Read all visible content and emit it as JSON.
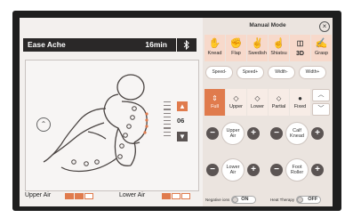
{
  "program": {
    "name": "Ease Ache",
    "time": "16min"
  },
  "bluetooth_icon": "bluetooth-icon",
  "body_panel": {
    "scroll_icon": "scroll-toggle-icon",
    "position_value": "06",
    "up_arrow": "▲",
    "down_arrow": "▼"
  },
  "air": {
    "upper_label": "Upper Air",
    "lower_label": "Lower Air",
    "upper_level": 2,
    "lower_level": 1,
    "max_level": 3,
    "color": "#e07b4d"
  },
  "manual": {
    "title": "Manual Mode",
    "close": "×",
    "techniques": [
      {
        "icon": "knead-icon",
        "label": "Knead"
      },
      {
        "icon": "flap-icon",
        "label": "Flap"
      },
      {
        "icon": "swedish-icon",
        "label": "Swedish"
      },
      {
        "icon": "shiatsu-icon",
        "label": "Shiatsu"
      },
      {
        "icon": "3d-icon",
        "label": "3D"
      },
      {
        "icon": "grasp-icon",
        "label": "Grasp"
      }
    ],
    "speed_width": [
      "Speed-",
      "Speed+",
      "Width-",
      "Width+"
    ],
    "zones": [
      {
        "icon": "full-icon",
        "label": "Full",
        "active": true
      },
      {
        "icon": "upper-icon",
        "label": "Upper",
        "active": false
      },
      {
        "icon": "lower-icon",
        "label": "Lower",
        "active": false
      },
      {
        "icon": "partial-icon",
        "label": "Partial",
        "active": false
      },
      {
        "icon": "fixed-icon",
        "label": "Fixed",
        "active": false
      }
    ],
    "zone_up": "︿",
    "zone_down": "﹀",
    "controls": [
      {
        "label": "Upper Air",
        "minus": "−",
        "plus": "+"
      },
      {
        "label": "Calf Knead",
        "minus": "−",
        "plus": "+"
      },
      {
        "label": "Lower Air",
        "minus": "−",
        "plus": "+"
      },
      {
        "label": "Foot Roller",
        "minus": "−",
        "plus": "+"
      }
    ],
    "negative_ions": {
      "label": "Negative ions",
      "value": "ON"
    },
    "heat_therapy": {
      "label": "Heat Therapy",
      "value": "OFF"
    }
  },
  "accent_color": "#e07b4d",
  "dark_color": "#2a2828"
}
